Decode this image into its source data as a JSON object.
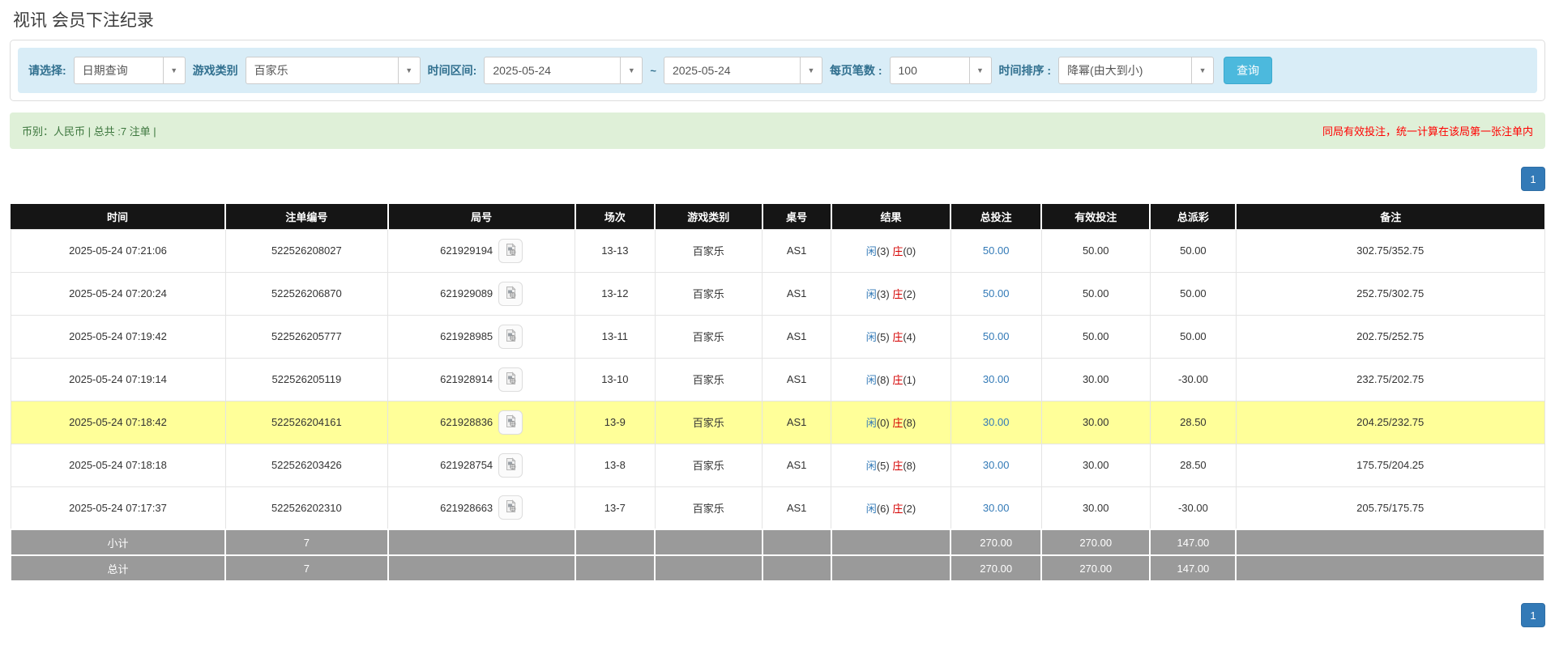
{
  "page": {
    "title": "视讯 会员下注纪录"
  },
  "filters": {
    "select_label": "请选择:",
    "query_type_value": "日期查询",
    "game_type_label": "游戏类别",
    "game_type_value": "百家乐",
    "time_range_label": "时间区间:",
    "date_from": "2025-05-24",
    "tilde": "~",
    "date_to": "2025-05-24",
    "page_size_label": "每页笔数 :",
    "page_size_value": "100",
    "sort_label": "时间排序 :",
    "sort_value": "降幂(由大到小)",
    "search_button": "查询"
  },
  "summary": {
    "left": "币别：人民币 | 总共 :7 注单 |",
    "right_notice": "同局有效投注，统一计算在该局第一张注单内"
  },
  "pagination": {
    "page": "1"
  },
  "icons": {
    "dropdown": "chevron-down-icon",
    "round_cell": "video-file-icon"
  },
  "colors": {
    "filter_bg": "#d9edf7",
    "filter_label": "#31708f",
    "search_button": "#4cb9dd",
    "summary_bg": "#dff0d8",
    "summary_text": "#3c763d",
    "notice_red": "#ff0000",
    "header_bg": "#151515",
    "highlight_row": "#ffff99",
    "subtotal_bg": "#9a9a9a",
    "link_blue": "#337ab7",
    "player_blue": "#337ab7",
    "banker_red": "#d40000",
    "negative_red": "#e60000",
    "pager_blue": "#337ab7"
  },
  "table": {
    "headers": [
      "时间",
      "注单编号",
      "局号",
      "场次",
      "游戏类别",
      "桌号",
      "结果",
      "总投注",
      "有效投注",
      "总派彩",
      "备注"
    ],
    "rows": [
      {
        "time": "2025-05-24 07:21:06",
        "bet_id": "522526208027",
        "round_id": "621929194",
        "session": "13-13",
        "game": "百家乐",
        "table_no": "AS1",
        "player": "闲",
        "player_num": "(3)",
        "banker": "庄",
        "banker_num": "(0)",
        "total_bet": "50.00",
        "valid_bet": "50.00",
        "payout": "50.00",
        "remark": "302.75/352.75",
        "highlight": false
      },
      {
        "time": "2025-05-24 07:20:24",
        "bet_id": "522526206870",
        "round_id": "621929089",
        "session": "13-12",
        "game": "百家乐",
        "table_no": "AS1",
        "player": "闲",
        "player_num": "(3)",
        "banker": "庄",
        "banker_num": "(2)",
        "total_bet": "50.00",
        "valid_bet": "50.00",
        "payout": "50.00",
        "remark": "252.75/302.75",
        "highlight": false
      },
      {
        "time": "2025-05-24 07:19:42",
        "bet_id": "522526205777",
        "round_id": "621928985",
        "session": "13-11",
        "game": "百家乐",
        "table_no": "AS1",
        "player": "闲",
        "player_num": "(5)",
        "banker": "庄",
        "banker_num": "(4)",
        "total_bet": "50.00",
        "valid_bet": "50.00",
        "payout": "50.00",
        "remark": "202.75/252.75",
        "highlight": false
      },
      {
        "time": "2025-05-24 07:19:14",
        "bet_id": "522526205119",
        "round_id": "621928914",
        "session": "13-10",
        "game": "百家乐",
        "table_no": "AS1",
        "player": "闲",
        "player_num": "(8)",
        "banker": "庄",
        "banker_num": "(1)",
        "total_bet": "30.00",
        "valid_bet": "30.00",
        "payout": "-30.00",
        "remark": "232.75/202.75",
        "highlight": false
      },
      {
        "time": "2025-05-24 07:18:42",
        "bet_id": "522526204161",
        "round_id": "621928836",
        "session": "13-9",
        "game": "百家乐",
        "table_no": "AS1",
        "player": "闲",
        "player_num": "(0)",
        "banker": "庄",
        "banker_num": "(8)",
        "total_bet": "30.00",
        "valid_bet": "30.00",
        "payout": "28.50",
        "remark": "204.25/232.75",
        "highlight": true
      },
      {
        "time": "2025-05-24 07:18:18",
        "bet_id": "522526203426",
        "round_id": "621928754",
        "session": "13-8",
        "game": "百家乐",
        "table_no": "AS1",
        "player": "闲",
        "player_num": "(5)",
        "banker": "庄",
        "banker_num": "(8)",
        "total_bet": "30.00",
        "valid_bet": "30.00",
        "payout": "28.50",
        "remark": "175.75/204.25",
        "highlight": false
      },
      {
        "time": "2025-05-24 07:17:37",
        "bet_id": "522526202310",
        "round_id": "621928663",
        "session": "13-7",
        "game": "百家乐",
        "table_no": "AS1",
        "player": "闲",
        "player_num": "(6)",
        "banker": "庄",
        "banker_num": "(2)",
        "total_bet": "30.00",
        "valid_bet": "30.00",
        "payout": "-30.00",
        "remark": "205.75/175.75",
        "highlight": false
      }
    ],
    "subtotal": {
      "label": "小计",
      "count": "7",
      "total_bet": "270.00",
      "valid_bet": "270.00",
      "payout": "147.00"
    },
    "total": {
      "label": "总计",
      "count": "7",
      "total_bet": "270.00",
      "valid_bet": "270.00",
      "payout": "147.00"
    }
  }
}
